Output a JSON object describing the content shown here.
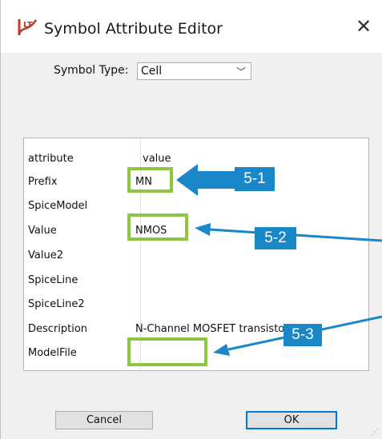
{
  "window": {
    "title": "Symbol Attribute Editor",
    "close_glyph": "✕",
    "app_icon": "ltspice-logo-icon"
  },
  "symbol_type": {
    "label": "Symbol Type:",
    "value": "Cell",
    "chevron": "﹀"
  },
  "grid": {
    "header": {
      "attribute": "attribute",
      "value": "value"
    },
    "rows": [
      {
        "attribute": "Prefix",
        "value": "MN"
      },
      {
        "attribute": "SpiceModel",
        "value": ""
      },
      {
        "attribute": "Value",
        "value": "NMOS"
      },
      {
        "attribute": "Value2",
        "value": ""
      },
      {
        "attribute": "SpiceLine",
        "value": ""
      },
      {
        "attribute": "SpiceLine2",
        "value": ""
      },
      {
        "attribute": "Description",
        "value": "N-Channel MOSFET transistor"
      },
      {
        "attribute": "ModelFile",
        "value": ""
      }
    ]
  },
  "buttons": {
    "cancel": "Cancel",
    "ok": "OK"
  },
  "annotations": {
    "step1": "5-1",
    "step2": "5-2",
    "step3": "5-3",
    "highlight_color": "#8dc63f",
    "badge_color": "#1a87c9"
  }
}
